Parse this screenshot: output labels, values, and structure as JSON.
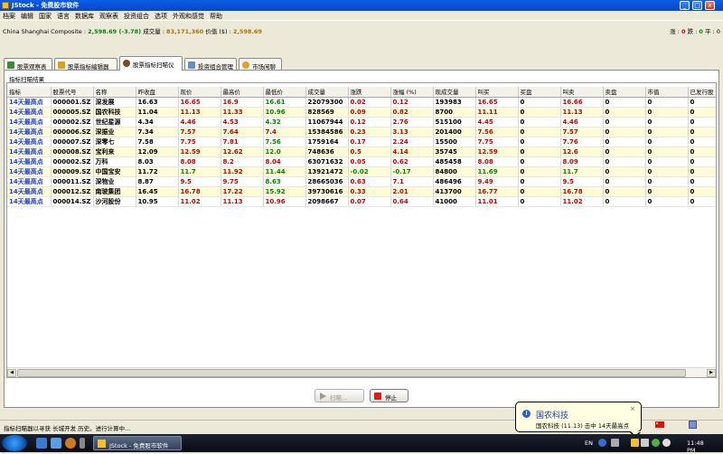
{
  "window": {
    "title": "JStock - 免费股市软件",
    "minimize": "_",
    "maximize": "□",
    "close": "x"
  },
  "menu": [
    "档案",
    "编辑",
    "国家",
    "语言",
    "数据库",
    "观察表",
    "投资组合",
    "选项",
    "外观和感觉",
    "帮助"
  ],
  "market": {
    "label": "China Shanghai Composite :",
    "index": "2,598.69 (-3.78)",
    "volume_label": "成交量 :",
    "volume": "83,171,360",
    "value_label": "价值 ($) :",
    "value": "2,598.69",
    "counts_up_label": "涨 :",
    "counts_up": "0",
    "counts_down_label": "跌 :",
    "counts_down": "0",
    "counts_flat_label": "平 :",
    "counts_flat": "0"
  },
  "tabs": [
    {
      "label": "股票观察表",
      "active": false,
      "icon": "watchlist-icon",
      "color": "#3a8a3a"
    },
    {
      "label": "股票指标编辑器",
      "active": false,
      "icon": "pencil-icon",
      "color": "#d8a020"
    },
    {
      "label": "股票指标扫瞄仪",
      "active": true,
      "icon": "scanner-icon",
      "color": "#7a4a20"
    },
    {
      "label": "投资组合管理",
      "active": false,
      "icon": "portfolio-icon",
      "color": "#6a8ac0"
    },
    {
      "label": "市场闲聊",
      "active": false,
      "icon": "chat-icon",
      "color": "#e0a030"
    }
  ],
  "results": {
    "group_title": "指标扫瞄结果",
    "columns": [
      "指标",
      "股票代号",
      "名称",
      "昨收盘",
      "现价",
      "最高价",
      "最低价",
      "成交量",
      "涨跌",
      "涨幅 (%)",
      "现成交量",
      "叫买",
      "买盘",
      "叫卖",
      "卖盘",
      "市值",
      "已发行股"
    ],
    "rows": [
      {
        "c": [
          "14天最高点",
          "000001.SZ",
          "深发展",
          "16.63",
          "16.65",
          "16.9",
          "16.61",
          "22079300",
          "0.02",
          "0.12",
          "193983",
          "16.65",
          "0",
          "16.66",
          "0",
          "0",
          "0"
        ],
        "s": [
          "ind",
          "nm",
          "nm",
          "nm",
          "up",
          "up",
          "dn",
          "nm",
          "up",
          "up",
          "nm",
          "up",
          "nm",
          "up",
          "nm",
          "nm",
          "nm"
        ]
      },
      {
        "c": [
          "14天最高点",
          "000005.SZ",
          "国农科技",
          "11.04",
          "11.13",
          "11.33",
          "10.96",
          "828569",
          "0.09",
          "0.82",
          "8700",
          "11.11",
          "0",
          "11.13",
          "0",
          "0",
          "0"
        ],
        "s": [
          "ind",
          "nm",
          "nm",
          "nm",
          "up",
          "up",
          "dn",
          "nm",
          "up",
          "up",
          "nm",
          "up",
          "nm",
          "up",
          "nm",
          "nm",
          "nm"
        ]
      },
      {
        "c": [
          "14天最高点",
          "000002.SZ",
          "世纪星源",
          "4.34",
          "4.46",
          "4.53",
          "4.32",
          "11067944",
          "0.12",
          "2.76",
          "515100",
          "4.45",
          "0",
          "4.46",
          "0",
          "0",
          "0"
        ],
        "s": [
          "ind",
          "nm",
          "nm",
          "nm",
          "up",
          "up",
          "dn",
          "nm",
          "up",
          "up",
          "nm",
          "up",
          "nm",
          "up",
          "nm",
          "nm",
          "nm"
        ]
      },
      {
        "c": [
          "14天最高点",
          "000006.SZ",
          "深振业",
          "7.34",
          "7.57",
          "7.64",
          "7.4",
          "15384586",
          "0.23",
          "3.13",
          "201400",
          "7.56",
          "0",
          "7.57",
          "0",
          "0",
          "0"
        ],
        "s": [
          "ind",
          "nm",
          "nm",
          "nm",
          "up",
          "up",
          "up",
          "nm",
          "up",
          "up",
          "nm",
          "up",
          "nm",
          "up",
          "nm",
          "nm",
          "nm"
        ]
      },
      {
        "c": [
          "14天最高点",
          "000007.SZ",
          "深零七",
          "7.58",
          "7.75",
          "7.81",
          "7.56",
          "1759164",
          "0.17",
          "2.24",
          "15500",
          "7.75",
          "0",
          "7.76",
          "0",
          "0",
          "0"
        ],
        "s": [
          "ind",
          "nm",
          "nm",
          "nm",
          "up",
          "up",
          "dn",
          "nm",
          "up",
          "up",
          "nm",
          "up",
          "nm",
          "up",
          "nm",
          "nm",
          "nm"
        ]
      },
      {
        "c": [
          "14天最高点",
          "000008.SZ",
          "宝利来",
          "12.09",
          "12.59",
          "12.62",
          "12.0",
          "748636",
          "0.5",
          "4.14",
          "35745",
          "12.59",
          "0",
          "12.6",
          "0",
          "0",
          "0"
        ],
        "s": [
          "ind",
          "nm",
          "nm",
          "nm",
          "up",
          "up",
          "dn",
          "nm",
          "up",
          "up",
          "nm",
          "up",
          "nm",
          "up",
          "nm",
          "nm",
          "nm"
        ]
      },
      {
        "c": [
          "14天最高点",
          "000002.SZ",
          "万科",
          "8.03",
          "8.08",
          "8.2",
          "8.04",
          "63071632",
          "0.05",
          "0.62",
          "485458",
          "8.08",
          "0",
          "8.09",
          "0",
          "0",
          "0"
        ],
        "s": [
          "ind",
          "nm",
          "nm",
          "nm",
          "up",
          "up",
          "up",
          "nm",
          "up",
          "up",
          "nm",
          "up",
          "nm",
          "up",
          "nm",
          "nm",
          "nm"
        ]
      },
      {
        "c": [
          "14天最高点",
          "000009.SZ",
          "中国宝安",
          "11.72",
          "11.7",
          "11.92",
          "11.44",
          "13921472",
          "-0.02",
          "-0.17",
          "84800",
          "11.69",
          "0",
          "11.7",
          "0",
          "0",
          "0"
        ],
        "s": [
          "ind",
          "nm",
          "nm",
          "nm",
          "dn",
          "up",
          "dn",
          "nm",
          "dn",
          "dn",
          "nm",
          "dn",
          "nm",
          "dn",
          "nm",
          "nm",
          "nm"
        ]
      },
      {
        "c": [
          "14天最高点",
          "000011.SZ",
          "深物业",
          "8.87",
          "9.5",
          "9.75",
          "8.63",
          "28665036",
          "0.63",
          "7.1",
          "486496",
          "9.49",
          "0",
          "9.5",
          "0",
          "0",
          "0"
        ],
        "s": [
          "ind",
          "nm",
          "nm",
          "nm",
          "up",
          "up",
          "dn",
          "nm",
          "up",
          "up",
          "nm",
          "up",
          "nm",
          "up",
          "nm",
          "nm",
          "nm"
        ]
      },
      {
        "c": [
          "14天最高点",
          "000012.SZ",
          "南玻集团",
          "16.45",
          "16.78",
          "17.22",
          "15.92",
          "39730616",
          "0.33",
          "2.01",
          "413700",
          "16.77",
          "0",
          "16.78",
          "0",
          "0",
          "0"
        ],
        "s": [
          "ind",
          "nm",
          "nm",
          "nm",
          "up",
          "up",
          "dn",
          "nm",
          "up",
          "up",
          "nm",
          "up",
          "nm",
          "up",
          "nm",
          "nm",
          "nm"
        ]
      },
      {
        "c": [
          "14天最高点",
          "000014.SZ",
          "沙河股份",
          "10.95",
          "11.02",
          "11.13",
          "10.96",
          "2098667",
          "0.07",
          "0.64",
          "41000",
          "11.01",
          "0",
          "11.02",
          "0",
          "0",
          "0"
        ],
        "s": [
          "ind",
          "nm",
          "nm",
          "nm",
          "up",
          "up",
          "up",
          "nm",
          "up",
          "up",
          "nm",
          "up",
          "nm",
          "up",
          "nm",
          "nm",
          "nm"
        ]
      }
    ]
  },
  "buttons": {
    "scan": "扫瞄...",
    "stop": "停止"
  },
  "statusbar": {
    "text": "指标扫瞄器以寻获 长城开发 历史。进行计算中..."
  },
  "balloon": {
    "title": "国农科技",
    "body": "国农科技 (11.13) 击中 14天最高点",
    "close": "×"
  },
  "taskbar": {
    "item": "JStock - 免费股市软件",
    "lang": "EN",
    "time": "11:48 PM"
  }
}
